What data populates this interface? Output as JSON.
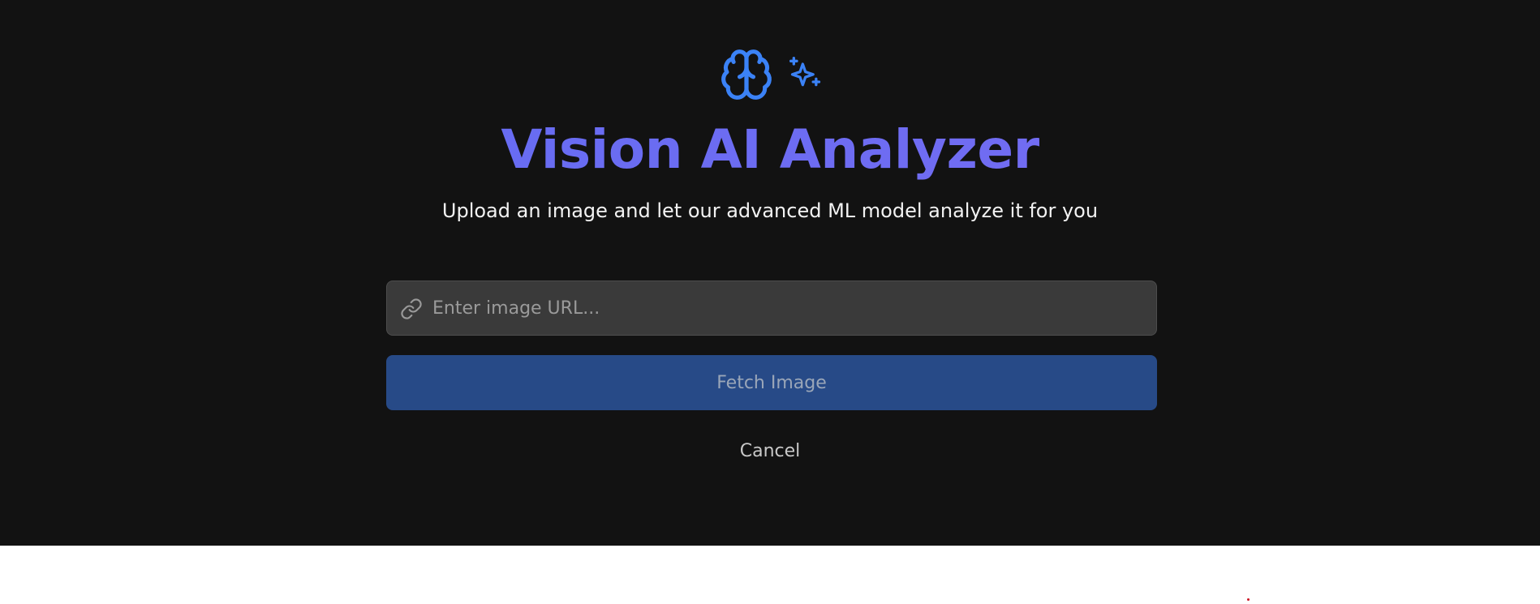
{
  "header": {
    "icons": [
      "brain-icon",
      "sparkles-icon"
    ],
    "title": "Vision AI Analyzer",
    "subtitle": "Upload an image and let our advanced ML model analyze it for you"
  },
  "url_form": {
    "icon": "link-icon",
    "placeholder": "Enter image URL...",
    "value": "",
    "fetch_label": "Fetch Image",
    "cancel_label": "Cancel"
  },
  "colors": {
    "background": "#121212",
    "accent": "#3b82f6",
    "title_gradient_start": "#5f6cf2",
    "title_gradient_end": "#7a6cf2",
    "input_background": "#3a3a3a",
    "button_background": "#274a87"
  }
}
